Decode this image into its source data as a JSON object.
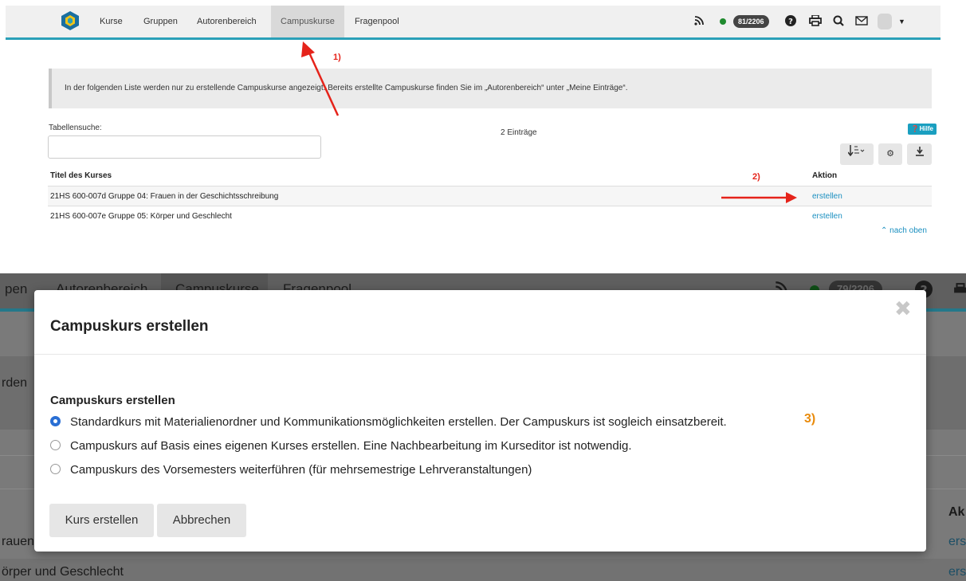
{
  "top": {
    "nav": {
      "items": [
        "Kurse",
        "Gruppen",
        "Autorenbereich",
        "Campuskurse",
        "Fragenpool"
      ],
      "active": "Campuskurse",
      "online_count": "81/2206",
      "icons": [
        "rss-icon",
        "online-dot-icon",
        "help-icon",
        "print-icon",
        "search-icon",
        "mail-icon",
        "avatar",
        "caret-down-icon"
      ]
    },
    "info_text": "In der folgenden Liste werden nur zu erstellende Campuskurse angezeigt. Bereits erstellte Campuskurse finden Sie im „Autorenbereich“ unter „Meine Einträge“.",
    "search_label": "Tabellensuche:",
    "entries_count": "2 Einträge",
    "help_label": "Hilfe",
    "table": {
      "headers": [
        "Titel des Kurses",
        "Aktion"
      ],
      "rows": [
        {
          "title": "21HS 600-007d Gruppe 04: Frauen in der Geschichtsschreibung",
          "action": "erstellen"
        },
        {
          "title": "21HS 600-007e Gruppe 05: Körper und Geschlecht",
          "action": "erstellen"
        }
      ]
    },
    "back_to_top": "nach oben",
    "annotations": [
      "1)",
      "2)"
    ]
  },
  "bottom": {
    "nav_items": [
      "pen",
      "Autorenbereich",
      "Campuskurse",
      "Fragenpool"
    ],
    "online_count": "79/2206",
    "bg_texts": [
      "rden",
      "Ak",
      "rauen",
      "ers",
      "örper und Geschlecht",
      "ers"
    ],
    "modal": {
      "title": "Campuskurs erstellen",
      "section_title": "Campuskurs erstellen",
      "options": [
        {
          "label": "Standardkurs mit Materialienordner und Kommunikationsmöglichkeiten erstellen. Der Campuskurs ist sogleich einsatzbereit.",
          "selected": true
        },
        {
          "label": "Campuskurs auf Basis eines eigenen Kurses erstellen. Eine Nachbearbeitung im Kurseditor ist notwendig.",
          "selected": false
        },
        {
          "label": "Campuskurs des Vorsemesters weiterführen (für mehrsemestrige Lehrveranstaltungen)",
          "selected": false
        }
      ],
      "buttons": {
        "create": "Kurs erstellen",
        "cancel": "Abbrechen"
      },
      "annotation": "3)"
    }
  },
  "colors": {
    "accent": "#2aa0b8",
    "link": "#1a8fc0",
    "annotation_red": "#e5231a",
    "annotation_orange": "#e98b0c"
  }
}
